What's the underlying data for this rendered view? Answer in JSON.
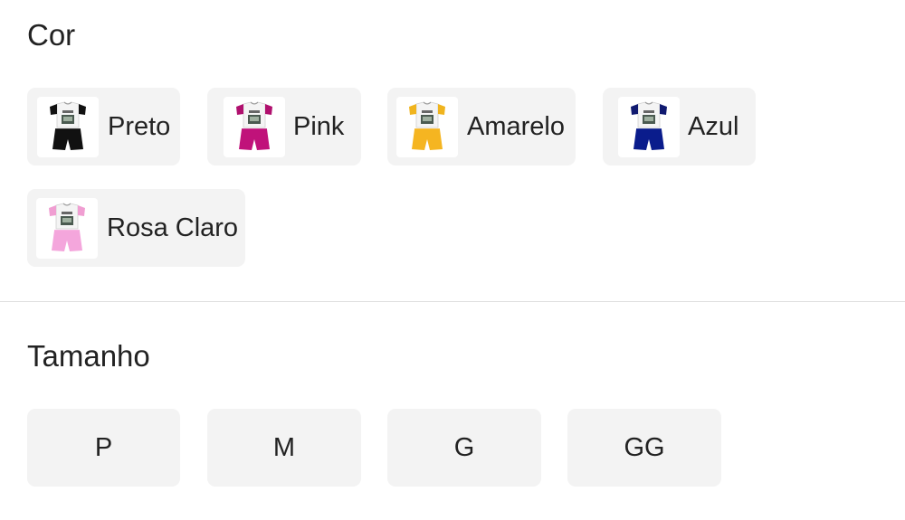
{
  "color_section": {
    "title": "Cor",
    "options": [
      {
        "label": "Preto",
        "shirt_sleeve": "#111111",
        "shorts": "#111111"
      },
      {
        "label": "Pink",
        "shirt_sleeve": "#b0106e",
        "shorts": "#c0127a"
      },
      {
        "label": "Amarelo",
        "shirt_sleeve": "#f0b41e",
        "shorts": "#f5b521"
      },
      {
        "label": "Azul",
        "shirt_sleeve": "#101a70",
        "shorts": "#0a1c8c"
      },
      {
        "label": "Rosa Claro",
        "shirt_sleeve": "#f09ed2",
        "shorts": "#f4a6dc"
      }
    ]
  },
  "size_section": {
    "title": "Tamanho",
    "options": [
      {
        "label": "P"
      },
      {
        "label": "M"
      },
      {
        "label": "G"
      },
      {
        "label": "GG"
      }
    ]
  },
  "colors": {
    "chip_background": "#f3f3f3",
    "divider": "#dedede",
    "text": "#222222"
  }
}
